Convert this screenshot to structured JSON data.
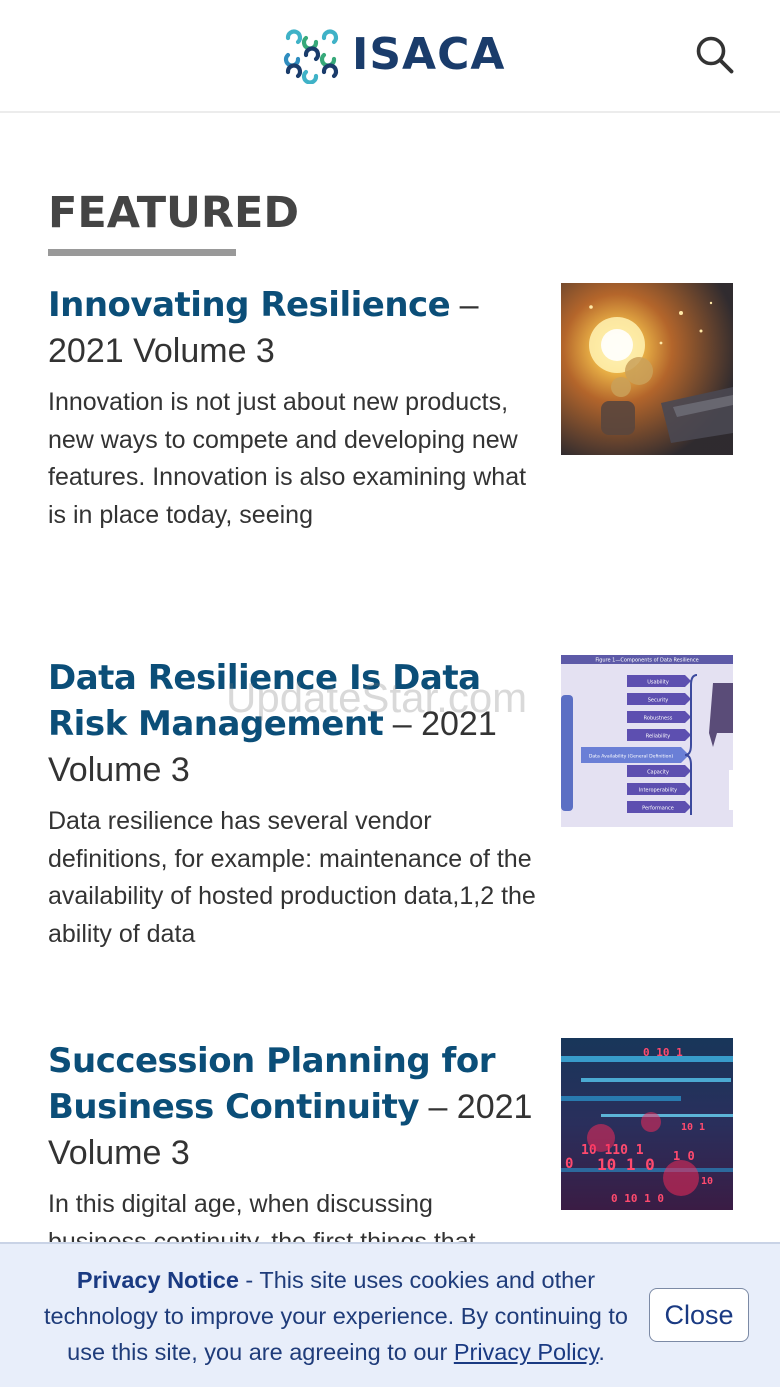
{
  "header": {
    "logo_text": "ISACA",
    "search_icon": "search-icon"
  },
  "featured": {
    "heading": "FEATURED",
    "articles": [
      {
        "title": "Innovating Resilience",
        "issue": " – 2021 Volume 3",
        "excerpt": "Innovation is not just about new products, new ways to compete and developing new features. Innovation is also examining what is in place today, seeing",
        "thumbnail": "lightbulb-gears-image"
      },
      {
        "title": "Data Resilience Is Data Risk Management",
        "issue": " – 2021 Volume 3",
        "excerpt": "Data resilience has several vendor definitions, for example: maintenance of the availability of hosted production data,1,2 the ability of data",
        "thumbnail": "data-resilience-diagram-image",
        "figure": {
          "caption": "Figure 1—Components of Data Resilience",
          "center_label": "Data Availability (General Definition)",
          "components": [
            "Usability",
            "Security",
            "Robustness",
            "Reliability",
            "Capacity",
            "Interoperability",
            "Performance"
          ]
        }
      },
      {
        "title": "Succession Planning for Business Continuity",
        "issue": " – 2021 Volume 3",
        "excerpt": "In this digital age, when discussing business continuity, the first things that",
        "thumbnail": "binary-code-image"
      }
    ]
  },
  "watermark": "UpdateStar.com",
  "privacy": {
    "title": "Privacy Notice",
    "message": " - This site uses cookies and other technology to improve your experience. By continuing to use this site, you are agreeing to our ",
    "link_label": "Privacy Policy",
    "end": ".",
    "close_label": "Close"
  },
  "colors": {
    "brand": "#1a3c6b",
    "link": "#0b4e78",
    "banner_bg": "#e8eefa"
  }
}
